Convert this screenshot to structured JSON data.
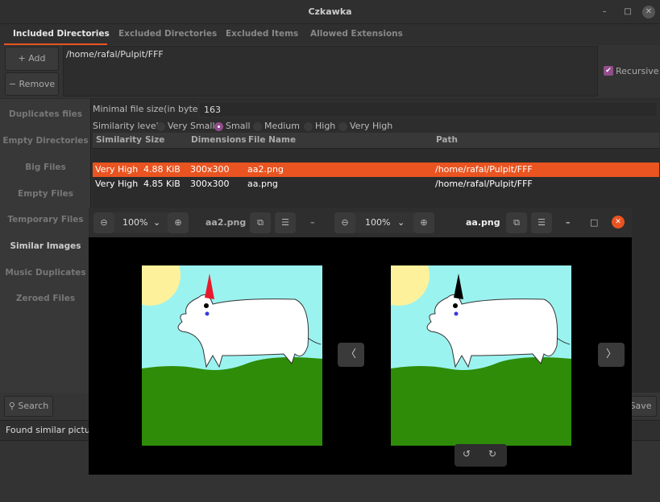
{
  "window": {
    "title": "Czkawka",
    "minimize": "–",
    "maximize": "□",
    "close": "✕"
  },
  "tabs": [
    {
      "label": "Included Directories",
      "active": true
    },
    {
      "label": "Excluded Directories"
    },
    {
      "label": "Excluded Items"
    },
    {
      "label": "Allowed Extensions"
    }
  ],
  "included": {
    "add_label": "+ Add",
    "remove_label": "− Remove",
    "paths": [
      "/home/rafal/Pulpit/FFF"
    ],
    "recursive_label": "Recursive",
    "recursive_checked": true
  },
  "sidebar": {
    "items": [
      {
        "label": "Duplicates files"
      },
      {
        "label": "Empty Directories"
      },
      {
        "label": "Big Files"
      },
      {
        "label": "Empty Files"
      },
      {
        "label": "Temporary Files"
      },
      {
        "label": "Similar Images",
        "active": true
      },
      {
        "label": "Music Duplicates"
      },
      {
        "label": "Zeroed Files"
      }
    ]
  },
  "options": {
    "min_size_label": "Minimal file size(in bytes)",
    "min_size_value": "163",
    "similarity_label": "Similarity level",
    "levels": [
      "Very Small",
      "Small",
      "Medium",
      "High",
      "Very High"
    ],
    "selected_level": "Small"
  },
  "table": {
    "columns": [
      "Similarity",
      "Size",
      "Dimensions",
      "File Name",
      "Path"
    ],
    "rows": [
      {
        "similarity": "Very High",
        "size": "4.88 KiB",
        "dimensions": "300x300",
        "name": "aa2.png",
        "path": "/home/rafal/Pulpit/FFF",
        "selected": true
      },
      {
        "similarity": "Very High",
        "size": "4.85 KiB",
        "dimensions": "300x300",
        "name": "aa.png",
        "path": "/home/rafal/Pulpit/FFF"
      }
    ]
  },
  "bottom": {
    "search_label": "Search",
    "save_label": "Save",
    "status": "Found similar pictures"
  },
  "viewer_left": {
    "zoom": "100%",
    "filename": "aa2.png",
    "minimize": "–",
    "horn_color": "#e8192c"
  },
  "viewer_right": {
    "zoom": "100%",
    "filename": "aa.png",
    "minimize": "–",
    "maximize": "□",
    "close": "✕",
    "horn_color": "#000000",
    "prev": "〈",
    "next": "〉"
  },
  "colors": {
    "accent": "#e95420",
    "check": "#924d8b"
  }
}
